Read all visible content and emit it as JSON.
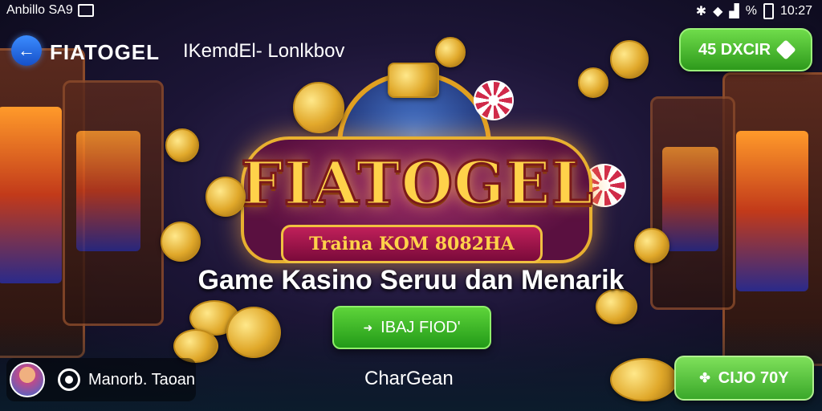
{
  "status_bar": {
    "left_text": "Anbillo SA9",
    "time": "10:27"
  },
  "header": {
    "app_name": "FIATOGEL",
    "subtitle": "IKemdEl- Lonlkbov"
  },
  "top_cta": {
    "label": "45 DXCIR"
  },
  "logo": {
    "title": "FIATOGEL",
    "ribbon": "Traina KOM 8082HA"
  },
  "tagline": "Game Kasino Seruu dan Menarik",
  "main_cta": {
    "label": "IBAJ FIOD'"
  },
  "bottom": {
    "user_label": "Manorb. Taoan",
    "center_label": "CharGean",
    "cta_label": "CIJO 70Y"
  },
  "colors": {
    "accent_green": "#2e9a1c",
    "accent_blue": "#1650c8",
    "gold": "#ffd24a"
  },
  "icons": [
    "back-arrow-icon",
    "bluetooth-icon",
    "wifi-icon",
    "signal-icon",
    "battery-icon",
    "ticket-icon",
    "camera-icon",
    "arrow-icon",
    "clover-icon"
  ]
}
